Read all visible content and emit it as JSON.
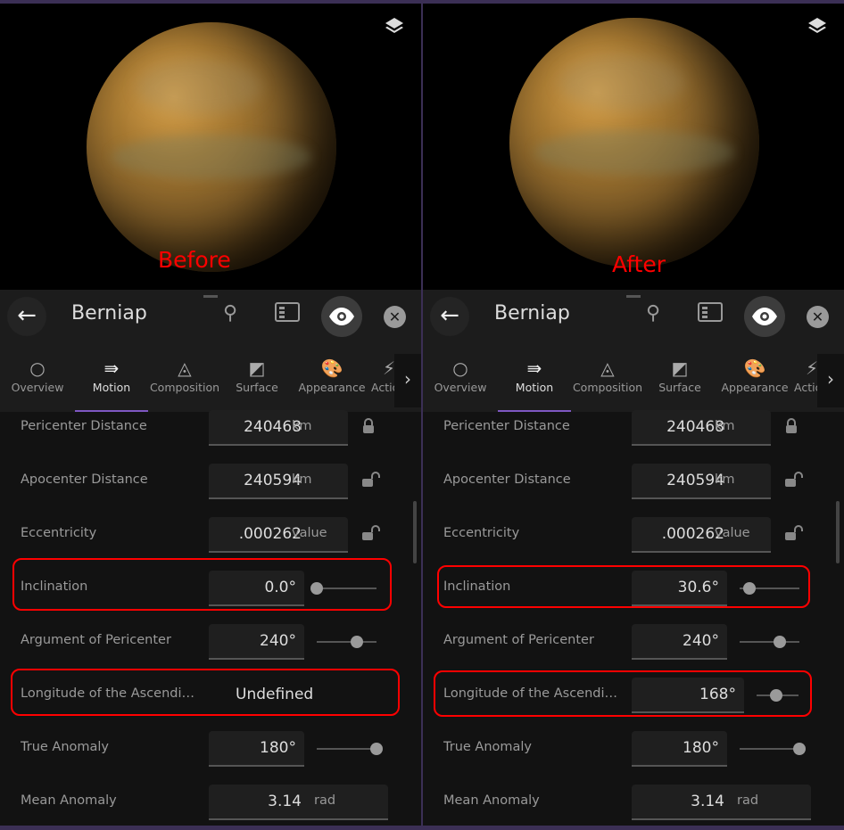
{
  "panels": [
    {
      "annotation": "Before",
      "title": "Berniap",
      "tabs": [
        "Overview",
        "Motion",
        "Composition",
        "Surface",
        "Appearance",
        "Actions"
      ],
      "active_tab": "Motion",
      "rows": [
        {
          "label": "Pericenter Distance",
          "value": "240468",
          "unit": "km",
          "lock": "locked"
        },
        {
          "label": "Apocenter Distance",
          "value": "240594",
          "unit": "km",
          "lock": "unlocked"
        },
        {
          "label": "Eccentricity",
          "value": ".000262",
          "unit": "value",
          "lock": "unlocked"
        },
        {
          "label": "Inclination",
          "value": "0.0°",
          "slider": 0.0,
          "highlight": true
        },
        {
          "label": "Argument of Pericenter",
          "value": "240°",
          "slider": 0.67
        },
        {
          "label": "Longitude of the Ascending Node",
          "value": "Undefined",
          "undefined": true,
          "highlight": true
        },
        {
          "label": "True Anomaly",
          "value": "180°",
          "slider": 1.0
        },
        {
          "label": "Mean Anomaly",
          "value": "3.14",
          "unit": "rad",
          "wide": true
        }
      ]
    },
    {
      "annotation": "After",
      "title": "Berniap",
      "tabs": [
        "Overview",
        "Motion",
        "Composition",
        "Surface",
        "Appearance",
        "Actions"
      ],
      "active_tab": "Motion",
      "rows": [
        {
          "label": "Pericenter Distance",
          "value": "240468",
          "unit": "km",
          "lock": "locked"
        },
        {
          "label": "Apocenter Distance",
          "value": "240594",
          "unit": "km",
          "lock": "unlocked"
        },
        {
          "label": "Eccentricity",
          "value": ".000262",
          "unit": "value",
          "lock": "unlocked"
        },
        {
          "label": "Inclination",
          "value": "30.6°",
          "slider": 0.17,
          "highlight": true
        },
        {
          "label": "Argument of Pericenter",
          "value": "240°",
          "slider": 0.67
        },
        {
          "label": "Longitude of the Ascending Node",
          "value": "168°",
          "slider": 0.47,
          "highlight": true
        },
        {
          "label": "True Anomaly",
          "value": "180°",
          "slider": 1.0
        },
        {
          "label": "Mean Anomaly",
          "value": "3.14",
          "unit": "rad",
          "wide": true
        }
      ]
    }
  ],
  "colors": {
    "accent": "#7e57c2",
    "highlight": "#ff0000",
    "annotation": "#ff0000"
  }
}
